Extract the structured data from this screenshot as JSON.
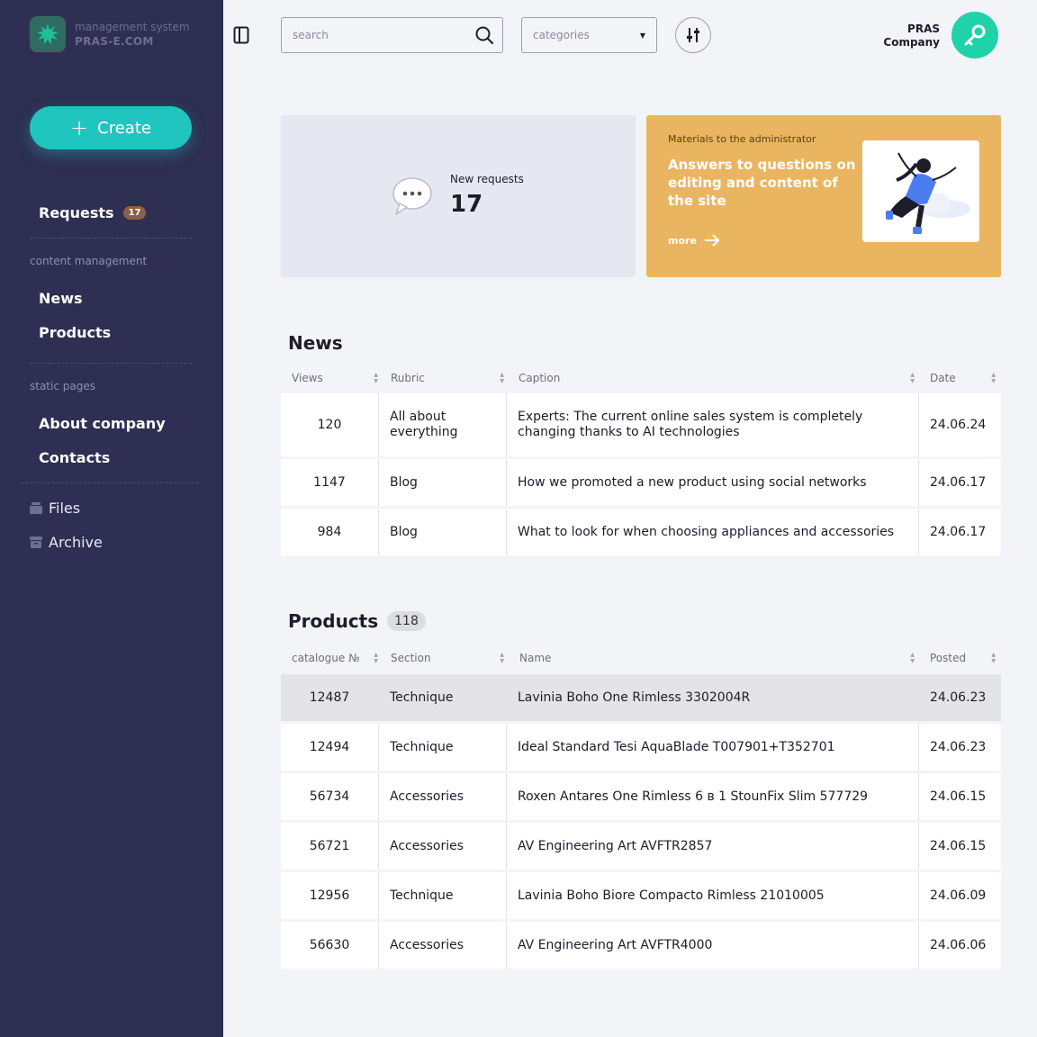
{
  "brand": {
    "subtitle": "management system",
    "name": "PRAS-E.COM",
    "logo_icon": "star-burst-icon"
  },
  "sidebar": {
    "create_label": "Create",
    "requests": {
      "label": "Requests",
      "badge": "17"
    },
    "content_section": "content management",
    "content_items": [
      "News",
      "Products"
    ],
    "static_section": "static pages",
    "static_items": [
      "About company",
      "Contacts"
    ],
    "files_label": "Files",
    "archive_label": "Archive"
  },
  "topbar": {
    "search_placeholder": "search",
    "category_value": "categories",
    "company_line1": "PRAS",
    "company_line2": "Company"
  },
  "cards": {
    "requests": {
      "label": "New requests",
      "count": "17"
    },
    "materials": {
      "kicker": "Materials to the administrator",
      "title": "Answers to questions on editing and content of the site",
      "more": "more"
    }
  },
  "news": {
    "title": "News",
    "columns": [
      "Views",
      "Rubric",
      "Caption",
      "Date"
    ],
    "rows": [
      {
        "views": "120",
        "rubric": "All about everything",
        "caption": "Experts: The current online sales system is completely changing thanks to AI technologies",
        "date": "24.06.24"
      },
      {
        "views": "1147",
        "rubric": "Blog",
        "caption": "How we promoted a new product using social networks",
        "date": "24.06.17"
      },
      {
        "views": "984",
        "rubric": "Blog",
        "caption": "What to look for when choosing appliances and accessories",
        "date": "24.06.17"
      }
    ]
  },
  "products": {
    "title": "Products",
    "count": "118",
    "columns": [
      "catalogue №",
      "Section",
      "Name",
      "Posted"
    ],
    "rows": [
      {
        "catalogue": "12487",
        "section": "Technique",
        "name": "Lavinia Boho One Rimless 3302004R",
        "posted": "24.06.23"
      },
      {
        "catalogue": "12494",
        "section": "Technique",
        "name": "Ideal Standard Tesi AquaBlade T007901+T352701",
        "posted": "24.06.23"
      },
      {
        "catalogue": "56734",
        "section": "Accessories",
        "name": "Roxen Antares One Rimless 6 в 1 StounFix Slim 577729",
        "posted": "24.06.15"
      },
      {
        "catalogue": "56721",
        "section": "Accessories",
        "name": "AV Engineering Art AVFTR2857",
        "posted": "24.06.15"
      },
      {
        "catalogue": "12956",
        "section": "Technique",
        "name": "Lavinia Boho Biore Compacto Rimless 21010005",
        "posted": "24.06.09"
      },
      {
        "catalogue": "56630",
        "section": "Accessories",
        "name": "AV Engineering Art AVFTR4000",
        "posted": "24.06.06"
      }
    ]
  },
  "colors": {
    "sidebar": "#2e2f52",
    "accent": "#20c5c0",
    "avatar": "#1ed3a9",
    "materials_card": "#e9b561",
    "badge": "#8a6148"
  }
}
